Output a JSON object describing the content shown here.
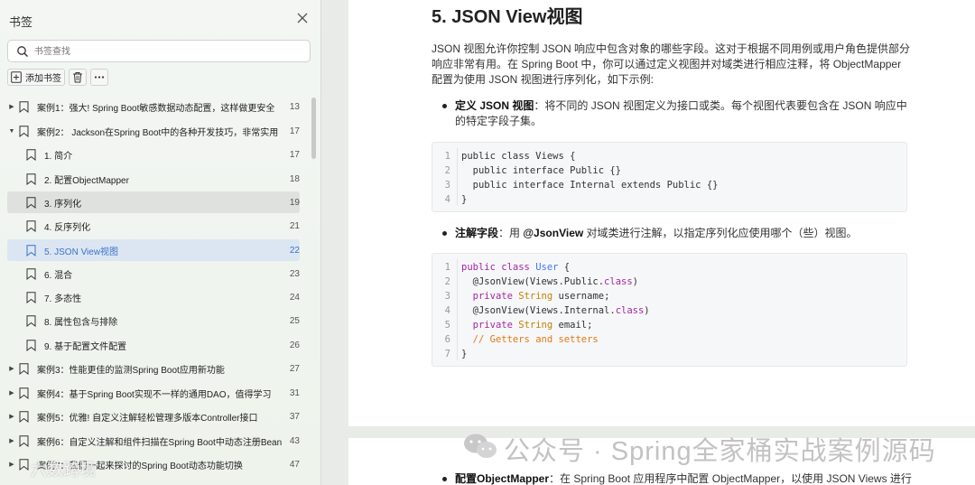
{
  "sidebar": {
    "title": "书签",
    "search_placeholder": "书签查找",
    "add_bookmark_label": "添加书签",
    "items": [
      {
        "label": "案例1：强大! Spring Boot敏感数据动态配置，这样做更安全",
        "page": "13",
        "level": 0,
        "expanded": false
      },
      {
        "label": "案例2： Jackson在Spring Boot中的各种开发技巧，非常实用",
        "page": "17",
        "level": 0,
        "expanded": true
      },
      {
        "label": "1. 简介",
        "page": "17",
        "level": 1
      },
      {
        "label": "2. 配置ObjectMapper",
        "page": "18",
        "level": 1
      },
      {
        "label": "3. 序列化",
        "page": "19",
        "level": 1,
        "state": "hover"
      },
      {
        "label": "4. 反序列化",
        "page": "21",
        "level": 1
      },
      {
        "label": "5. JSON View视图",
        "page": "22",
        "level": 1,
        "state": "current"
      },
      {
        "label": "6. 混合",
        "page": "23",
        "level": 1
      },
      {
        "label": "7. 多态性",
        "page": "24",
        "level": 1
      },
      {
        "label": "8. 属性包含与排除",
        "page": "25",
        "level": 1
      },
      {
        "label": "9. 基于配置文件配置",
        "page": "26",
        "level": 1
      },
      {
        "label": "案例3：性能更佳的监测Spring Boot应用新功能",
        "page": "27",
        "level": 0,
        "expanded": false
      },
      {
        "label": "案例4：基于Spring Boot实现不一样的通用DAO，值得学习",
        "page": "31",
        "level": 0,
        "expanded": false
      },
      {
        "label": "案例5：优雅! 自定义注解轻松管理多版本Controller接口",
        "page": "37",
        "level": 0,
        "expanded": false
      },
      {
        "label": "案例6：自定义注解和组件扫描在Spring Boot中动态注册Bean",
        "page": "43",
        "level": 0,
        "expanded": false
      },
      {
        "label": "案例7：我们一起来探讨的Spring Boot动态功能切换",
        "page": "47",
        "level": 0,
        "expanded": false
      }
    ]
  },
  "doc": {
    "heading": "5. JSON View视图",
    "intro": "JSON 视图允许你控制 JSON 响应中包含对象的哪些字段。这对于根据不同用例或用户角色提供部分响应非常有用。在 Spring Boot 中，你可以通过定义视图并对域类进行相应注释，将 ObjectMapper 配置为使用 JSON 视图进行序列化，如下示例:",
    "bullet1_bold": "定义 JSON 视图",
    "bullet1_text": "：将不同的 JSON 视图定义为接口或类。每个视图代表要包含在 JSON 响应中的特定字段子集。",
    "bullet2_bold": "注解字段",
    "bullet2_mid": "：用 ",
    "bullet2_code": "@JsonView",
    "bullet2_text": " 对域类进行注解，以指定序列化应使用哪个（些）视图。",
    "bullet3_bold": "配置ObjectMapper",
    "bullet3_text": "：在 Spring Boot 应用程序中配置 ObjectMapper，以使用 JSON Views 进行",
    "code1": [
      "public class Views {",
      "  public interface Public {}",
      "  public interface Internal extends Public {}",
      "}"
    ],
    "code2": [
      "public class User {",
      "  @JsonView(Views.Public.class)",
      "  private String username;",
      "  @JsonView(Views.Internal.class)",
      "  private String email;",
      "  // Getters and setters",
      "}"
    ]
  },
  "watermark": {
    "main": "公众号 · Spring全家桶实战案例源码",
    "corner": "六数跨境"
  }
}
